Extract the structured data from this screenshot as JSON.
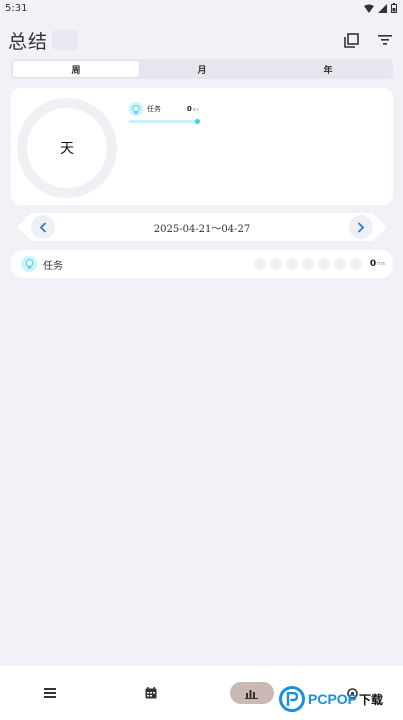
{
  "status_bar": {
    "time": "5:31"
  },
  "header": {
    "title": "总结"
  },
  "tabs": [
    {
      "label": "周",
      "active": true
    },
    {
      "label": "月",
      "active": false
    },
    {
      "label": "年",
      "active": false
    }
  ],
  "summary": {
    "ring_label": "天",
    "task": {
      "label": "任务",
      "value": "0",
      "unit": "hrs"
    }
  },
  "date_nav": {
    "range": "2025-04-21～04-27"
  },
  "task_row": {
    "label": "任务",
    "value": "0",
    "unit": "hrs",
    "day_dots": 7
  },
  "watermark": {
    "text": "PCPOP",
    "cn": "下载"
  },
  "colors": {
    "background": "#f1f2f7",
    "accent_cyan": "#38d3ea",
    "active_nav": "#c9b8b4",
    "nav_arrow": "#2a7fc9"
  }
}
